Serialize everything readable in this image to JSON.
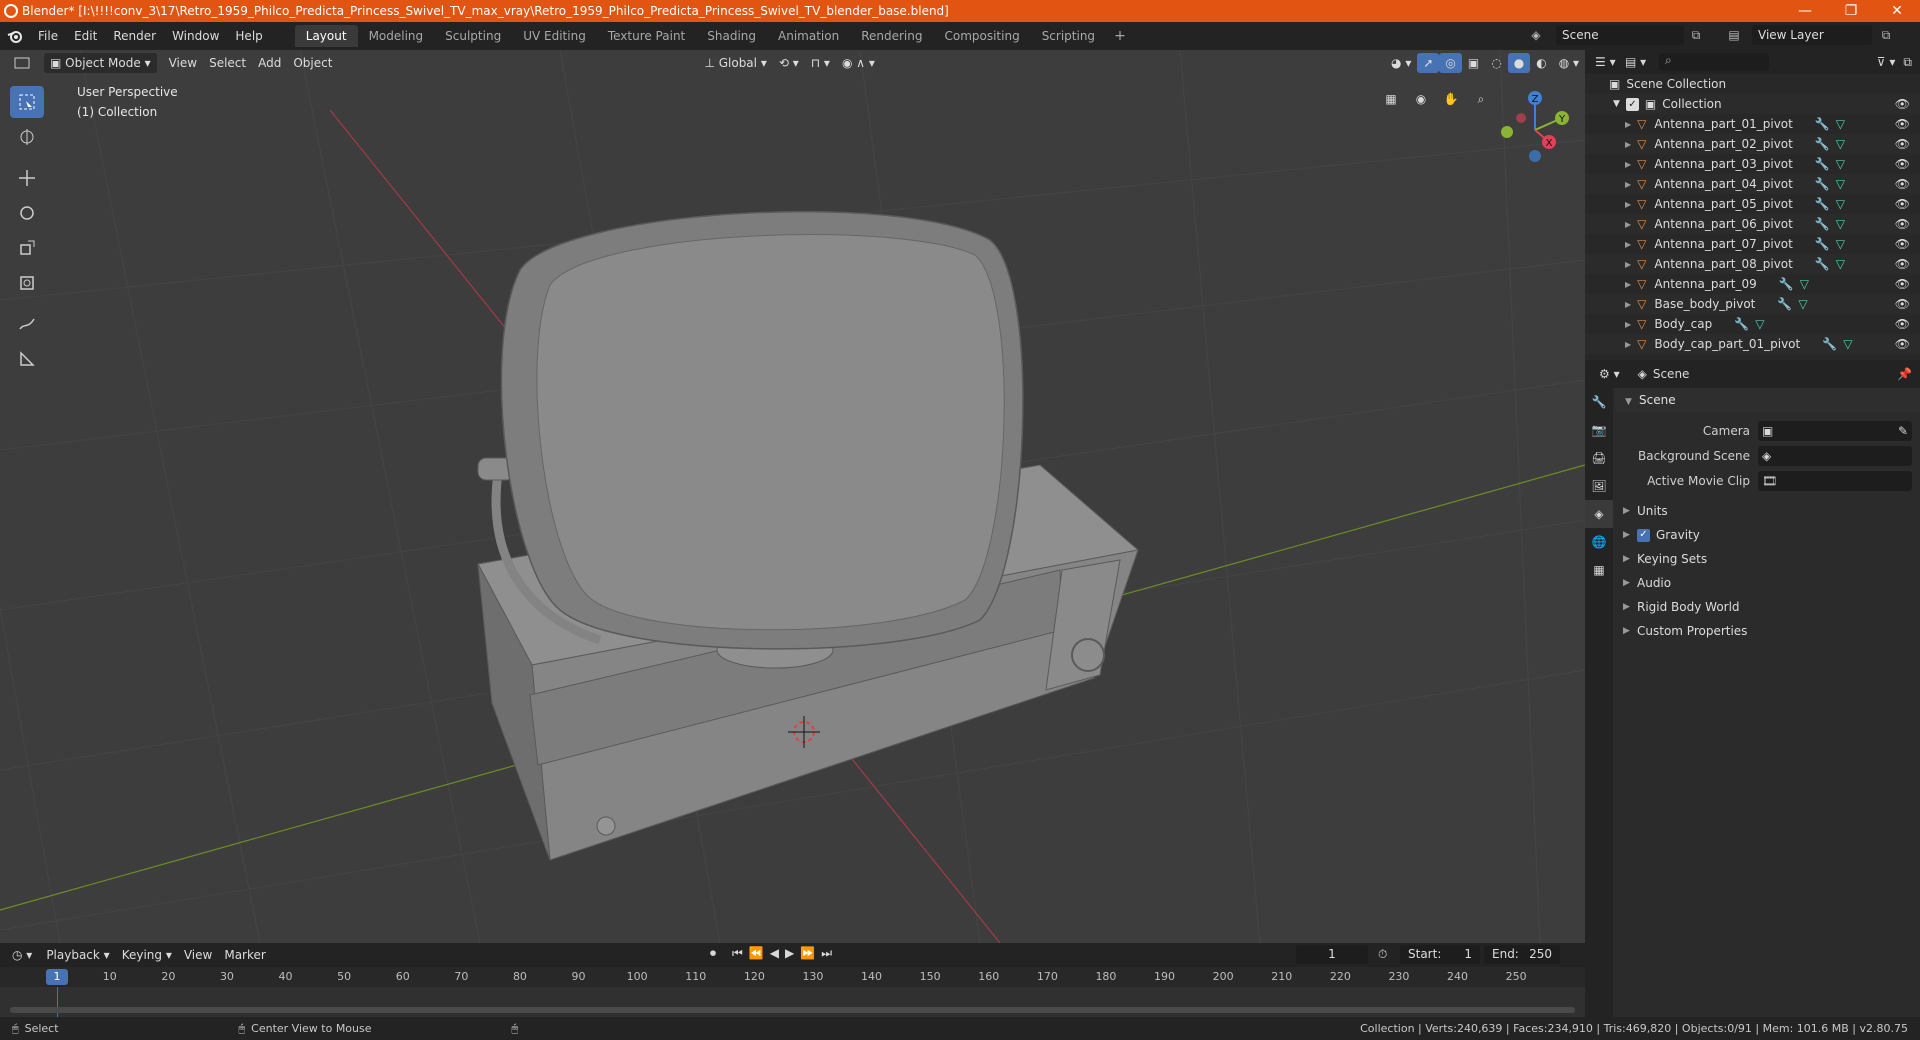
{
  "titlebar": {
    "title": "Blender* [I:\\!!!!conv_3\\17\\Retro_1959_Philco_Predicta_Princess_Swivel_TV_max_vray\\Retro_1959_Philco_Predicta_Princess_Swivel_TV_blender_base.blend]",
    "minimize": "—",
    "maximize": "❐",
    "close": "✕"
  },
  "menu": [
    "File",
    "Edit",
    "Render",
    "Window",
    "Help"
  ],
  "workspaces": [
    "Layout",
    "Modeling",
    "Sculpting",
    "UV Editing",
    "Texture Paint",
    "Shading",
    "Animation",
    "Rendering",
    "Compositing",
    "Scripting"
  ],
  "active_workspace": "Layout",
  "scene_name": "Scene",
  "view_layer": "View Layer",
  "viewport": {
    "mode": "Object Mode",
    "menus": [
      "View",
      "Select",
      "Add",
      "Object"
    ],
    "orientation": "Global",
    "perspective_label": "User Perspective",
    "collection_label": "(1) Collection",
    "gizmo": {
      "x": "X",
      "y": "Y",
      "z": "Z"
    }
  },
  "outliner": {
    "root": "Scene Collection",
    "collection": "Collection",
    "items": [
      "Antenna_part_01_pivot",
      "Antenna_part_02_pivot",
      "Antenna_part_03_pivot",
      "Antenna_part_04_pivot",
      "Antenna_part_05_pivot",
      "Antenna_part_06_pivot",
      "Antenna_part_07_pivot",
      "Antenna_part_08_pivot",
      "Antenna_part_09",
      "Base_body_pivot",
      "Body_cap",
      "Body_cap_part_01_pivot"
    ]
  },
  "properties": {
    "header_title": "Scene",
    "panel_title": "Scene",
    "camera_label": "Camera",
    "bg_scene_label": "Background Scene",
    "movie_clip_label": "Active Movie Clip",
    "subpanels": [
      "Units",
      "Gravity",
      "Keying Sets",
      "Audio",
      "Rigid Body World",
      "Custom Properties"
    ],
    "gravity_checked": true
  },
  "timeline": {
    "menus": [
      "Playback",
      "Keying",
      "View",
      "Marker"
    ],
    "current_frame": "1",
    "start_label": "Start:",
    "start": "1",
    "end_label": "End:",
    "end": "250",
    "ruler": [
      "1",
      "10",
      "20",
      "30",
      "40",
      "50",
      "60",
      "70",
      "80",
      "90",
      "100",
      "110",
      "120",
      "130",
      "140",
      "150",
      "160",
      "170",
      "180",
      "190",
      "200",
      "210",
      "220",
      "230",
      "240",
      "250"
    ]
  },
  "statusbar": {
    "select": "Select",
    "center_view": "Center View to Mouse",
    "stats": "Collection | Verts:240,639 | Faces:234,910 | Tris:469,820 | Objects:0/91 | Mem: 101.6 MB | v2.80.75"
  },
  "colors": {
    "accent": "#4772b3",
    "titlebar": "#e25412",
    "x_axis": "#a33a4a",
    "y_axis": "#6b8e23"
  }
}
